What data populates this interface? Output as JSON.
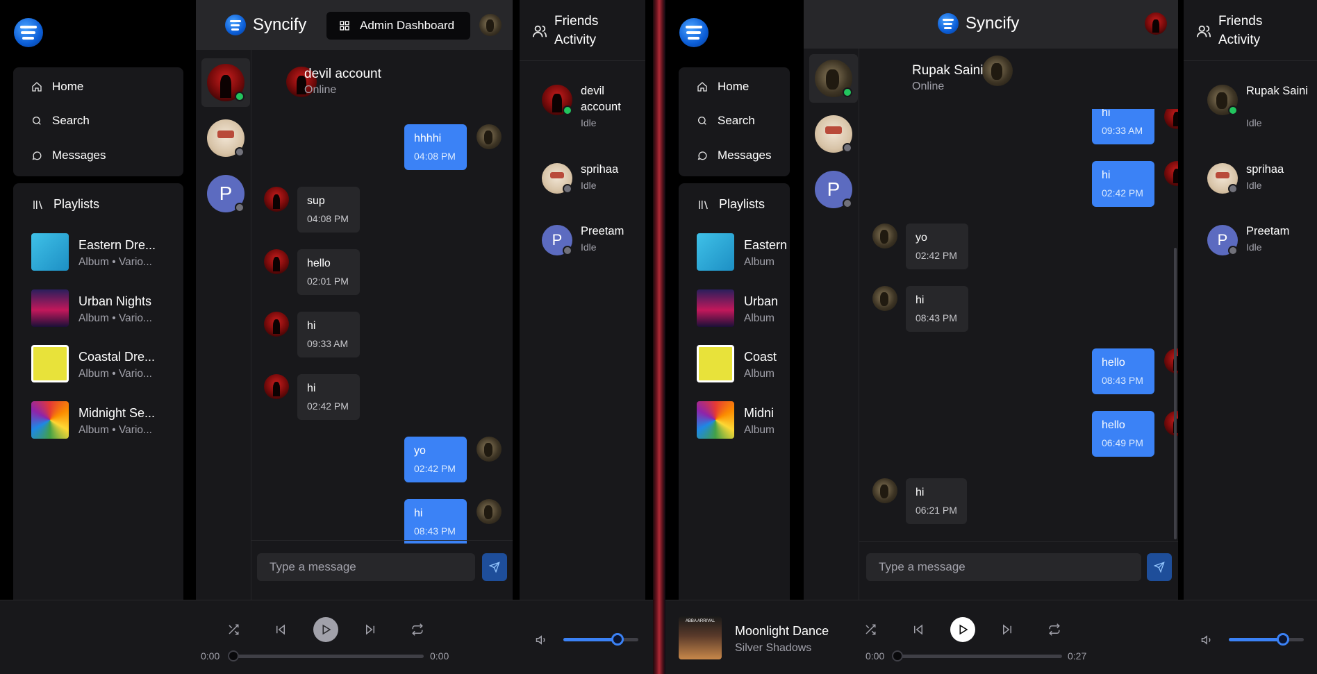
{
  "left": {
    "nav": [
      {
        "label": "Home",
        "icon": "home-icon"
      },
      {
        "label": "Search",
        "icon": "search-icon"
      },
      {
        "label": "Messages",
        "icon": "message-icon"
      }
    ],
    "playlists_label": "Playlists",
    "playlists": [
      {
        "name": "Eastern Dre...",
        "sub": "Album • Vario..."
      },
      {
        "name": "Urban Nights",
        "sub": "Album • Vario..."
      },
      {
        "name": "Coastal Dre...",
        "sub": "Album • Vario..."
      },
      {
        "name": "Midnight Se...",
        "sub": "Album • Vario..."
      }
    ],
    "brand": "Syncify",
    "admin_button": "Admin Dashboard",
    "chat": {
      "name": "devil account",
      "status": "Online",
      "messages": [
        {
          "dir": "out",
          "text": "hhhhi",
          "time": "04:08 PM"
        },
        {
          "dir": "in",
          "text": "sup",
          "time": "04:08 PM"
        },
        {
          "dir": "in",
          "text": "hello",
          "time": "02:01 PM"
        },
        {
          "dir": "in",
          "text": "hi",
          "time": "09:33 AM"
        },
        {
          "dir": "in",
          "text": "hi",
          "time": "02:42 PM"
        },
        {
          "dir": "out",
          "text": "yo",
          "time": "02:42 PM"
        },
        {
          "dir": "out",
          "text": "hi",
          "time": "08:43 PM"
        }
      ],
      "input_placeholder": "Type a message"
    },
    "friends_title": "Friends Activity",
    "friends": [
      {
        "name": "devil account",
        "status": "Idle"
      },
      {
        "name": "sprihaa",
        "status": "Idle"
      },
      {
        "name": "Preetam",
        "status": "Idle"
      }
    ],
    "contact_initial": "P",
    "player": {
      "time_current": "0:00",
      "time_total": "0:00",
      "volume": 0.72
    }
  },
  "right": {
    "nav": [
      {
        "label": "Home",
        "icon": "home-icon"
      },
      {
        "label": "Search",
        "icon": "search-icon"
      },
      {
        "label": "Messages",
        "icon": "message-icon"
      }
    ],
    "playlists_label": "Playlists",
    "playlists": [
      {
        "name": "Eastern",
        "sub": "Album"
      },
      {
        "name": "Urban",
        "sub": "Album"
      },
      {
        "name": "Coast",
        "sub": "Album"
      },
      {
        "name": "Midni",
        "sub": "Album"
      }
    ],
    "brand": "Syncify",
    "chat": {
      "name": "Rupak Saini",
      "status": "Online",
      "messages": [
        {
          "dir": "out",
          "text": "hi",
          "time": "09:33 AM"
        },
        {
          "dir": "out",
          "text": "hi",
          "time": "02:42 PM"
        },
        {
          "dir": "in",
          "text": "yo",
          "time": "02:42 PM"
        },
        {
          "dir": "in",
          "text": "hi",
          "time": "08:43 PM"
        },
        {
          "dir": "out",
          "text": "hello",
          "time": "08:43 PM"
        },
        {
          "dir": "out",
          "text": "hello",
          "time": "06:49 PM"
        },
        {
          "dir": "in",
          "text": "hi",
          "time": "06:21 PM"
        }
      ],
      "input_placeholder": "Type a message"
    },
    "friends_title": "Friends Activity",
    "friends": [
      {
        "name": "Rupak Saini",
        "status": "Idle"
      },
      {
        "name": "sprihaa",
        "status": "Idle"
      },
      {
        "name": "Preetam",
        "status": "Idle"
      }
    ],
    "contact_initial": "P",
    "player": {
      "track_title": "Moonlight Dance",
      "track_artist": "Silver Shadows",
      "album_art_text": "ABBA ARRIVAL",
      "time_current": "0:00",
      "time_total": "0:27",
      "volume": 0.72
    }
  },
  "colors": {
    "accent": "#3b82f6",
    "online": "#22c55e",
    "idle": "#71717a",
    "panel": "#18181b",
    "surface": "#27272a"
  }
}
